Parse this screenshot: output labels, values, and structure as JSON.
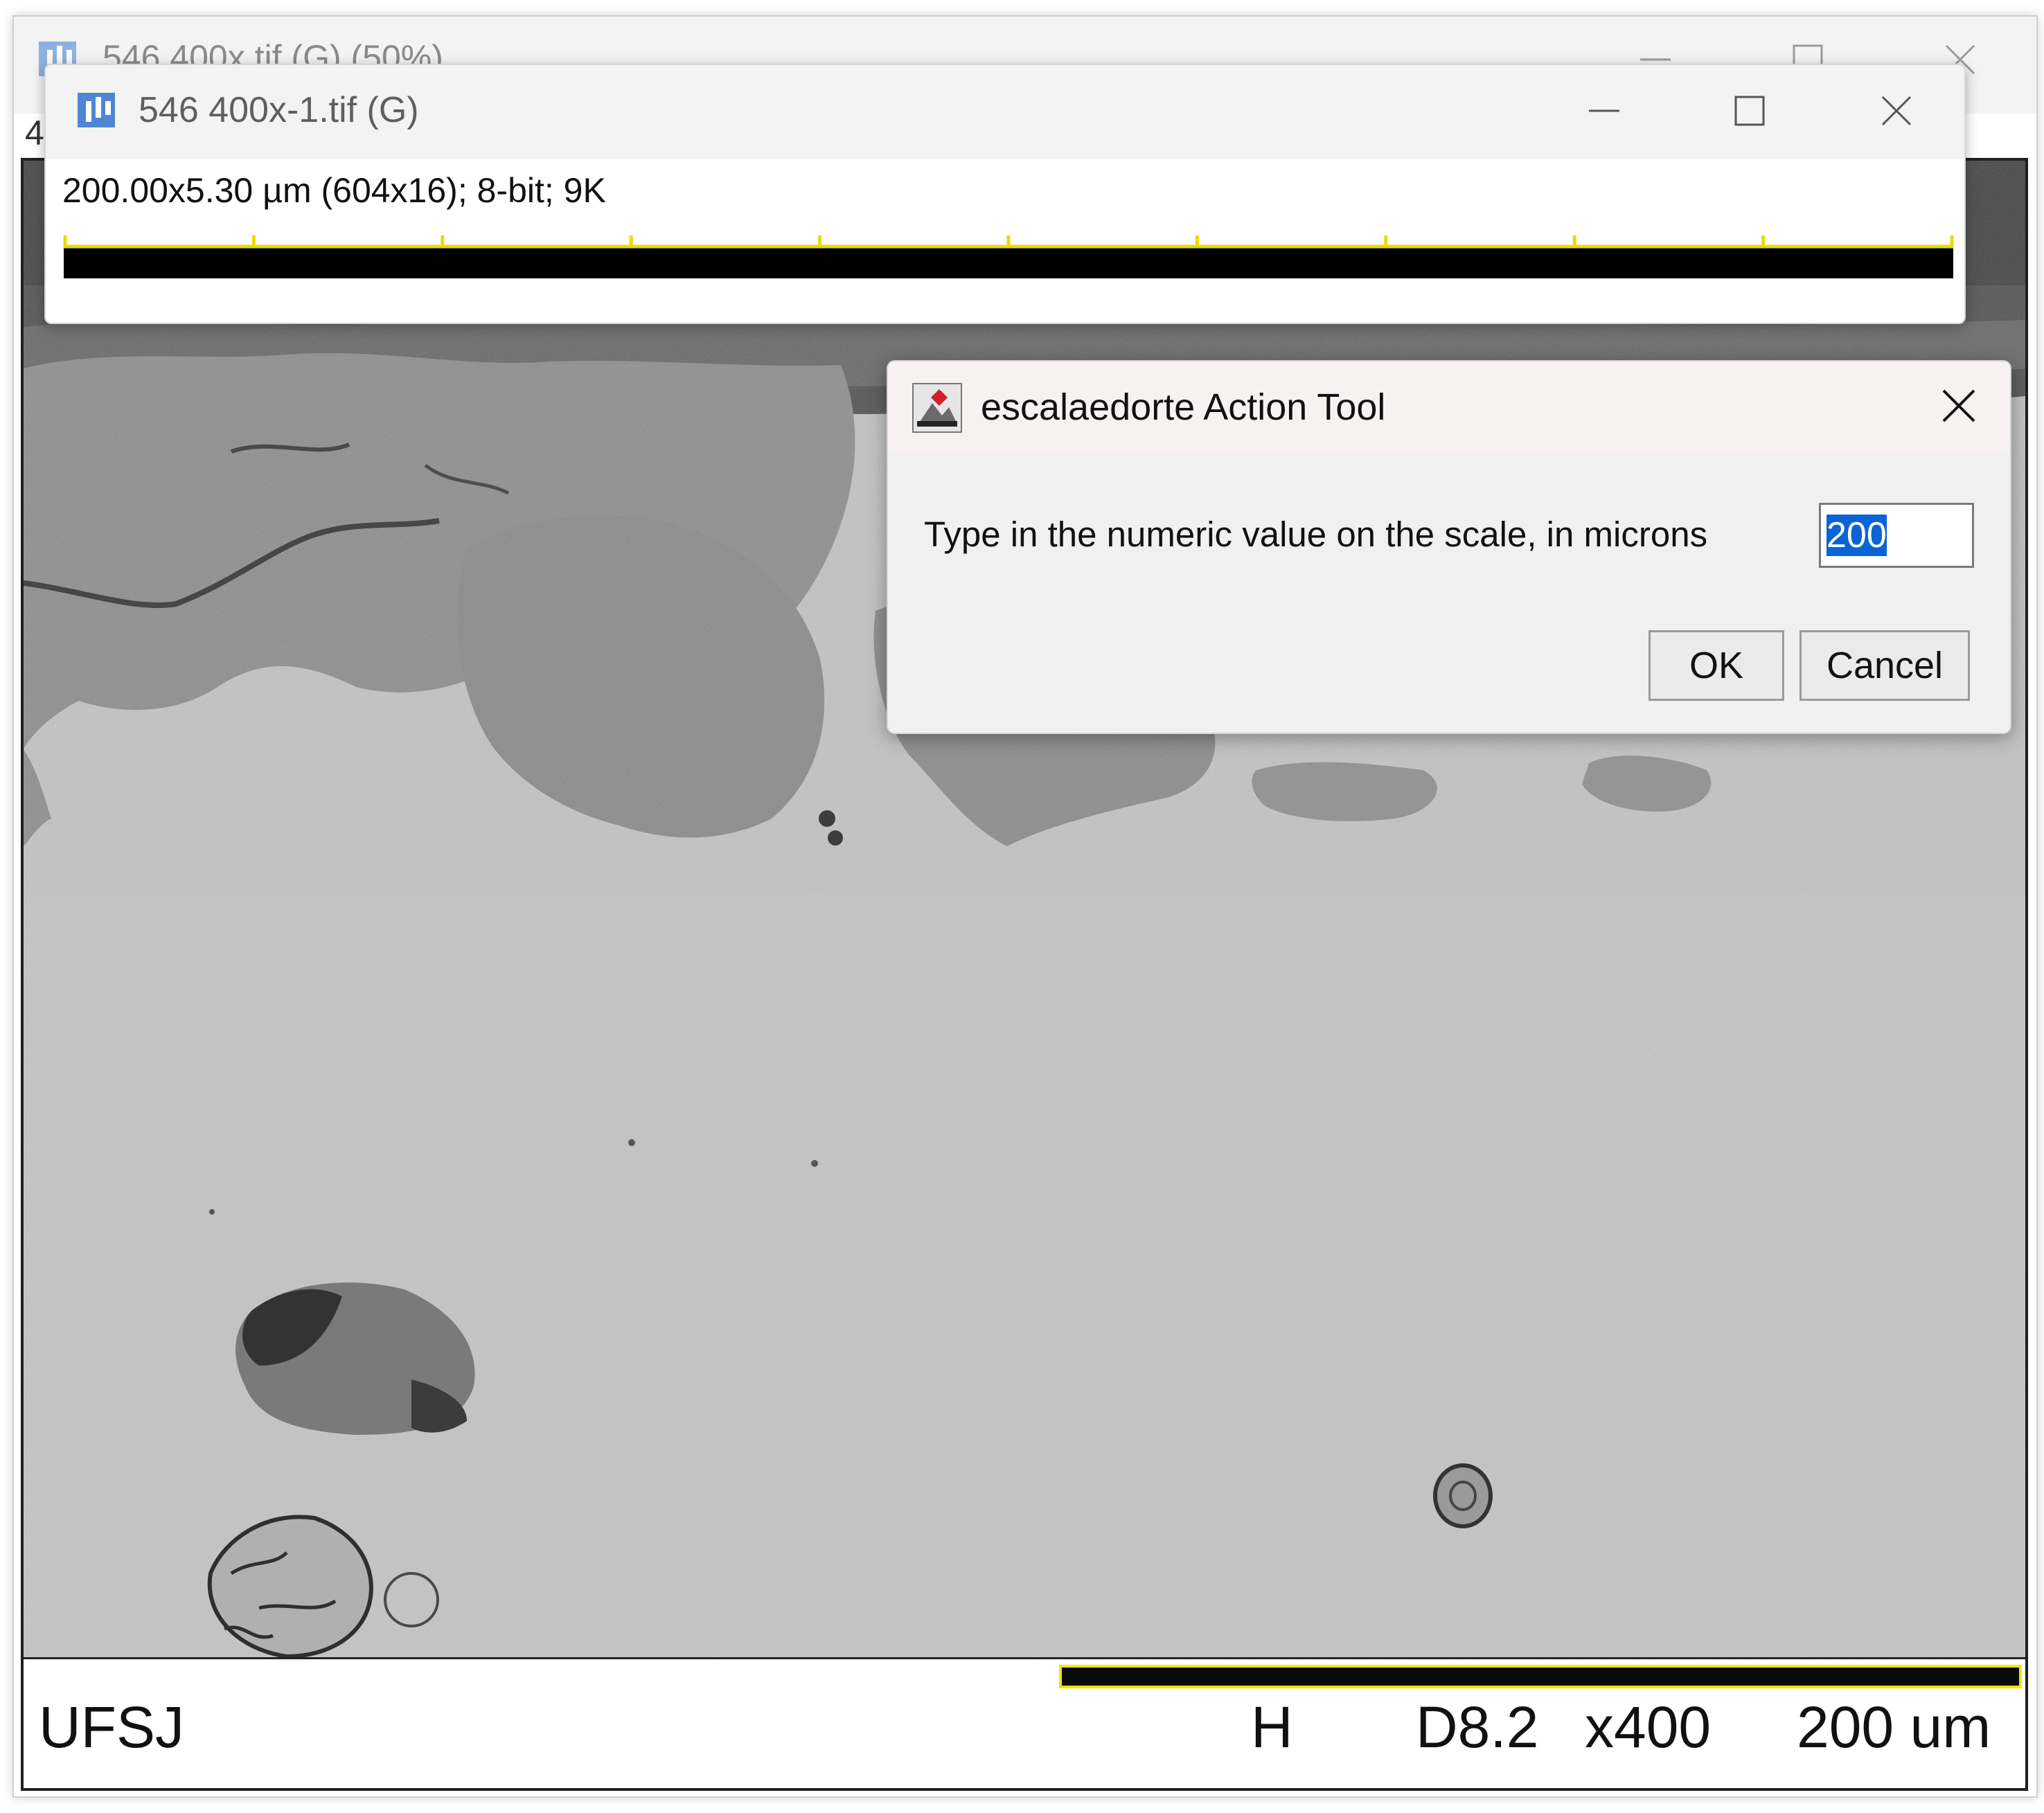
{
  "back_window": {
    "title": "546 400x.tif (G) (50%)",
    "info_fragment": "4"
  },
  "sem_image": {
    "labels": {
      "institution": "UFSJ",
      "mode": "H",
      "working_distance": "D8.2",
      "magnification": "x400",
      "scale": "200 um"
    },
    "scalebar_color": "#f2e600"
  },
  "scale_window": {
    "title": "546 400x-1.tif (G)",
    "info": "200.00x5.30 µm (604x16); 8-bit; 9K",
    "tick_count": 11,
    "tick_color": "#e8dc00"
  },
  "dialog": {
    "title": "escalaedorte Action Tool",
    "prompt": "Type in the numeric value on the scale, in microns",
    "input_value": "200",
    "ok_label": "OK",
    "cancel_label": "Cancel",
    "selection_color": "#0a64d6"
  },
  "icons": {
    "app_icon": "imagej-icon",
    "minimize": "minimize-icon",
    "maximize": "maximize-icon",
    "close": "close-icon",
    "dialog_icon": "action-tool-icon"
  }
}
